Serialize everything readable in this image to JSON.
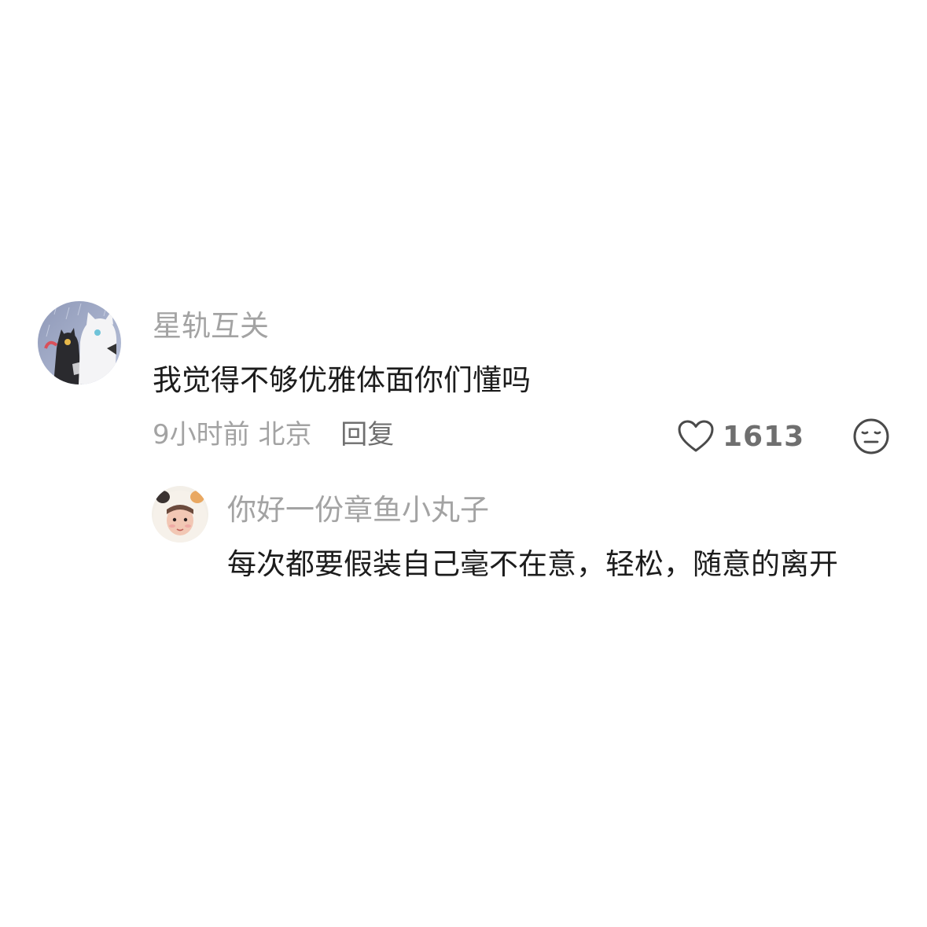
{
  "comment": {
    "username": "星轨互关",
    "text": "我觉得不够优雅体面你们懂吗",
    "time": "9小时前",
    "location": "北京",
    "reply_label": "回复",
    "likes": "1613",
    "like_icon": "heart-outline-icon",
    "dislike_icon": "neutral-face-icon",
    "avatar": "cartoon-cats-avatar"
  },
  "reply": {
    "username": "你好一份章鱼小丸子",
    "text": "每次都要假装自己毫不在意，轻松，随意的离开",
    "avatar": "person-in-animal-hat-avatar"
  },
  "colors": {
    "background": "#ffffff",
    "username": "#a3a3a3",
    "content": "#1c1c1c",
    "action": "#6f6f6f"
  }
}
